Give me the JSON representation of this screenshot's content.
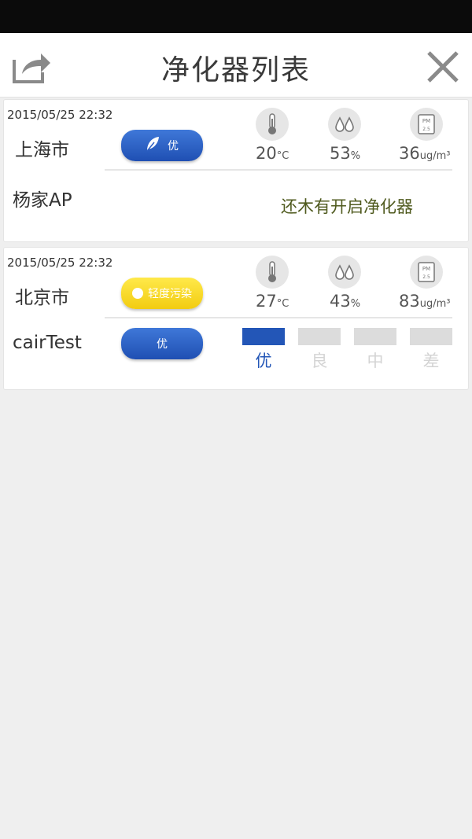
{
  "header": {
    "title": "净化器列表",
    "share_icon": "share-icon",
    "close_icon": "close-icon"
  },
  "cards": [
    {
      "timestamp": "2015/05/25 22:32",
      "city": "上海市",
      "air_quality": {
        "label": "优",
        "color": "#2356b7",
        "icon": "leaf-icon"
      },
      "temperature": {
        "value": "20",
        "unit": "°C"
      },
      "humidity": {
        "value": "53",
        "unit": "%"
      },
      "pm25": {
        "value": "36",
        "unit": "ug/m³"
      },
      "device": {
        "name": "杨家AP",
        "message": "还木有开启净化器"
      }
    },
    {
      "timestamp": "2015/05/25 22:32",
      "city": "北京市",
      "air_quality": {
        "label": "轻度污染",
        "color": "#f2cc11",
        "icon": "dot-icon"
      },
      "temperature": {
        "value": "27",
        "unit": "°C"
      },
      "humidity": {
        "value": "43",
        "unit": "%"
      },
      "pm25": {
        "value": "83",
        "unit": "ug/m³"
      },
      "device": {
        "name": "cairTest",
        "status_label": "优",
        "levels": [
          "优",
          "良",
          "中",
          "差"
        ],
        "active_level": "优"
      }
    }
  ]
}
